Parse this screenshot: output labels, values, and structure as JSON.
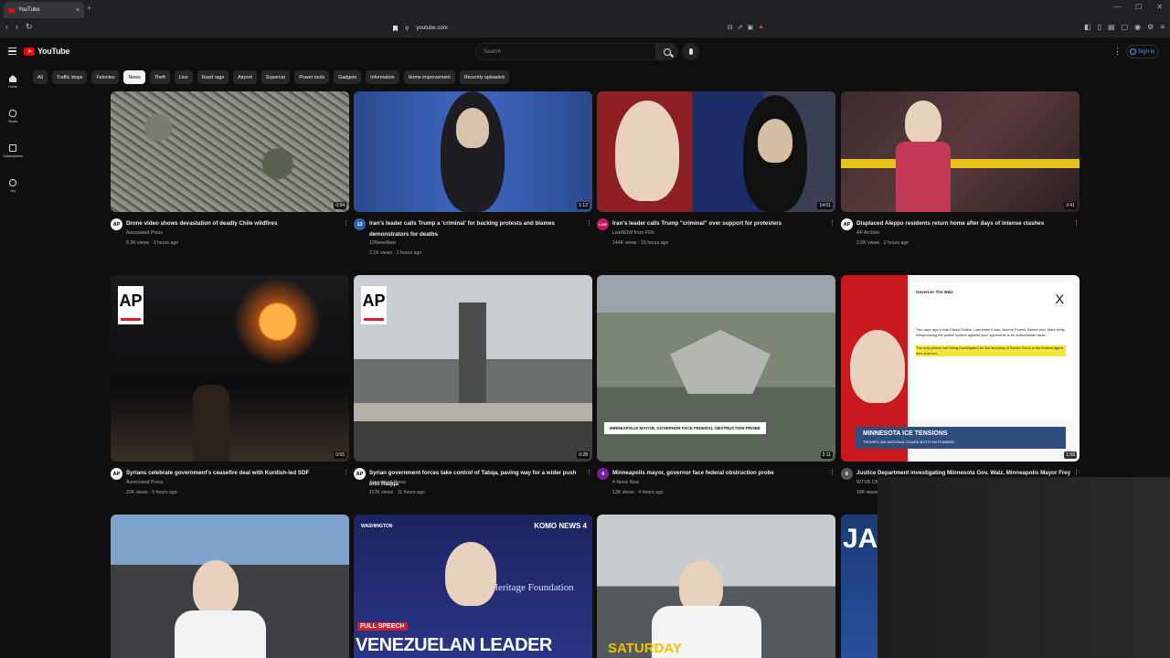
{
  "browser": {
    "tab_title": "YouTube",
    "tab_close": "×",
    "new_tab": "+",
    "url": "youtube.com",
    "window_controls": [
      "—",
      "☐",
      "✕"
    ]
  },
  "header": {
    "logo_text": "YouTube",
    "search_placeholder": "Search",
    "signin_label": "Sign in",
    "more_icon": "⋮"
  },
  "sidebar": {
    "items": [
      {
        "label": "Home",
        "icon": "home-icon"
      },
      {
        "label": "Shorts",
        "icon": "shorts-icon"
      },
      {
        "label": "Subscriptions",
        "icon": "subscriptions-icon"
      },
      {
        "label": "You",
        "icon": "you-icon"
      }
    ]
  },
  "chips": [
    "All",
    "Traffic stops",
    "Felonies",
    "News",
    "Theft",
    "Live",
    "Road rage",
    "Airport",
    "Supercar",
    "Power tools",
    "Gadgets",
    "Information",
    "Home improvement",
    "Recently uploaded"
  ],
  "active_chip": "News",
  "videos": [
    {
      "title": "Drone video shows devastation of deadly Chile wildfires",
      "channel": "Associated Press",
      "stats": "8.3K views · 3 hours ago",
      "duration": "0:34",
      "avatar": "AP"
    },
    {
      "title": "Iran's leader calls Trump a 'criminal' for backing protests and blames demonstrators for deaths",
      "channel": "12NewsNow",
      "stats": "2.1K views · 2 hours ago",
      "duration": "1:12",
      "avatar": "12"
    },
    {
      "title": "Iran's leader calls Trump \"criminal\" over support for protesters",
      "channel": "LiveNOW from FOX",
      "stats": "144K views · 15 hours ago",
      "duration": "14:01",
      "avatar": "LIVE"
    },
    {
      "title": "Displaced Aleppo residents return home after days of intense clashes",
      "channel": "AP Archive",
      "stats": "2.5K views · 2 hours ago",
      "duration": "0:41",
      "avatar": "AP"
    },
    {
      "title": "Syrians celebrate government's ceasefire deal with Kurdish-led SDF",
      "channel": "Associated Press",
      "stats": "22K views · 5 hours ago",
      "duration": "0:55",
      "avatar": "AP"
    },
    {
      "title": "Syrian government forces take control of Tabqa, paving way for a wider push into Raqqa",
      "channel": "Associated Press",
      "stats": "117K views · 11 hours ago",
      "duration": "0:28",
      "avatar": "AP"
    },
    {
      "title": "Minneapolis mayor, governor face federal obstruction probe",
      "channel": "4 News Now",
      "stats": "13K views · 4 hours ago",
      "duration": "2:11",
      "avatar": "4"
    },
    {
      "title": "Justice Department investigating Minnesota Gov. Walz, Minneapolis Mayor Frey",
      "channel": "WTVR CBS",
      "stats": "18K views",
      "duration": "1:58",
      "avatar": "6"
    }
  ],
  "thumb_text": {
    "ap": "AP",
    "minneapolis_caption": "MINNEAPOLIS MAYOR, GOVERNOR FACE FEDERAL OBSTRUCTION PROBE",
    "tweet_author": "Governor Tim Walz",
    "tweet_body": "Two days ago it was Elissa Slotkin. Last week it was Jerome Powell. Before that, Mark Kelly. Weaponizing the justice system against your opponents is an authoritarian tactic.",
    "tweet_highlight": "The only person not being investigated for the shooting of Renee Good is the federal agent who shot her.",
    "tweet_x": "X",
    "ice_headline": "MINNESOTA ICE TENSIONS",
    "ice_sub": "TROOPS, MN NATIONAL GUARD BOTH ON STANDBY",
    "washington": "WASHINGTON",
    "komo": "KOMO NEWS 4",
    "full_speech": "FULL SPEECH",
    "venezuelan": "VENEZUELAN LEADER",
    "heritage": "Heritage Foundation",
    "cbs_saturday": "SATURDAY",
    "jak": "JAK"
  }
}
